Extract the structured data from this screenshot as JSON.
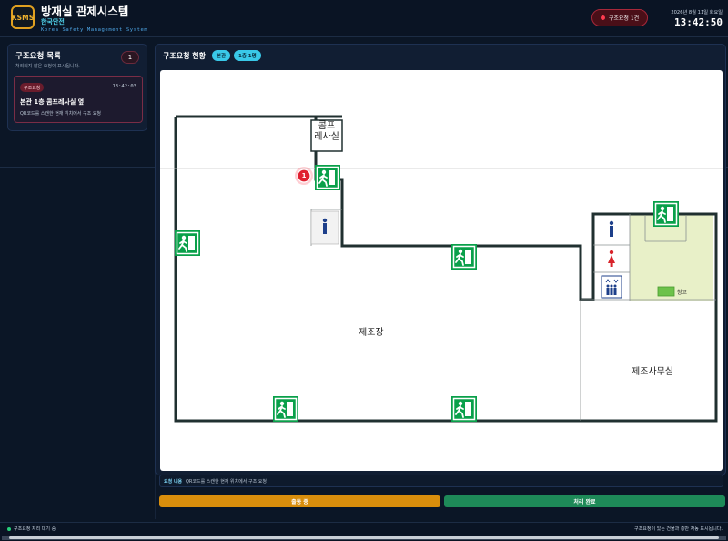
{
  "header": {
    "logo_text": "KSMS",
    "title": "방재실 관제시스템",
    "org": "한국안전",
    "subtitle": "Korea Safety Management System",
    "alert_badge": "구조요청 1건",
    "date": "2026년 8월 11일 화요일",
    "time": "13:42:50"
  },
  "request_list": {
    "title": "구조요청 목록",
    "description": "처리되지 않은 요청이 표시됩니다.",
    "count": "1",
    "items": [
      {
        "tag": "구조요청",
        "time": "13:42:03",
        "title": "본관 1층 콤프레사실 옆",
        "description": "QR코드를 스캔한 현재 위치에서 구조 요청"
      }
    ]
  },
  "status": {
    "title": "구조요청 현황",
    "building": "본관",
    "floor": "1층 1명"
  },
  "floor_map": {
    "rooms": {
      "comp_line1": "콤프",
      "comp_line2": "레사실",
      "factory": "제조장",
      "office": "제조사무실",
      "storage": "창고"
    },
    "marker": "1"
  },
  "request_detail": {
    "label": "요청 내용",
    "text": "QR코드를 스캔한 현재 위치에서 구조 요청"
  },
  "actions": {
    "dispatch": "출동 중",
    "complete": "처리 완료"
  },
  "footer": {
    "status": "구조요청 처리 대기 중",
    "note": "구조요청이 있는 건물과 층만 자동 표시됩니다."
  },
  "colors": {
    "accent": "#39c8e8",
    "alert": "#ff3b4f",
    "dispatch": "#d98e0c",
    "complete": "#1e8a58",
    "exit_sign": "#0aa04a",
    "storage_area": "#e8f0c8"
  }
}
